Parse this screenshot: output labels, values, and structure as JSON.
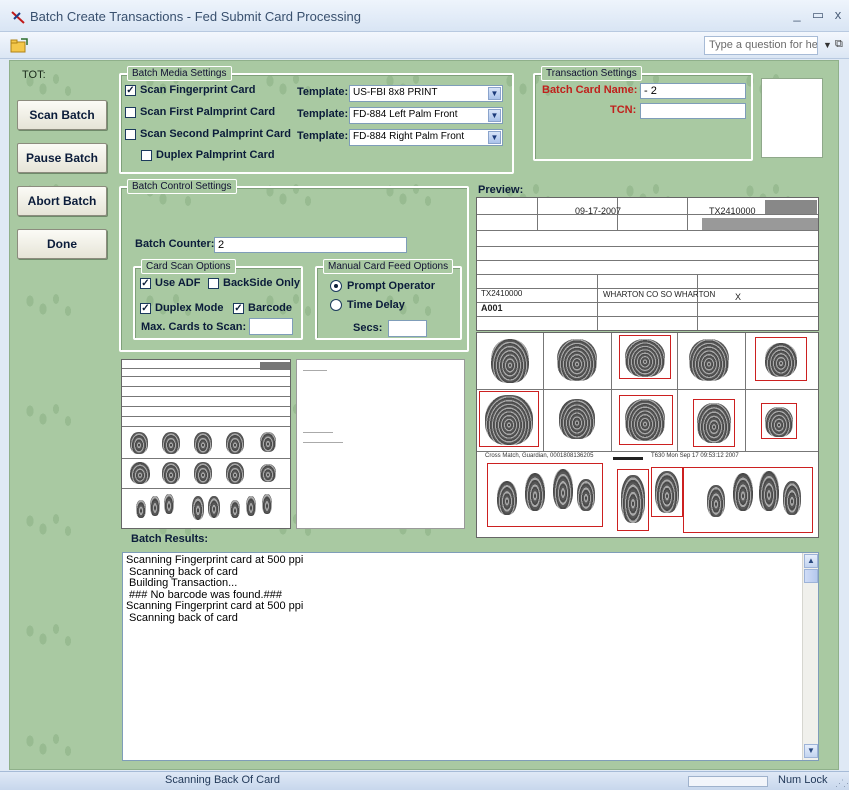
{
  "window": {
    "title": "Batch Create Transactions - Fed Submit Card Processing",
    "minimize_glyph": "_",
    "restore_glyph": "▭",
    "close_glyph": "x"
  },
  "toolbar": {
    "help_placeholder": "Type a question for help"
  },
  "left": {
    "tot_label": "TOT:",
    "buttons": [
      "Scan Batch",
      "Pause Batch",
      "Abort Batch",
      "Done"
    ]
  },
  "media_settings": {
    "legend": "Batch Media Settings",
    "rows": [
      {
        "label": "Scan Fingerprint Card",
        "checked": true,
        "template_label": "Template:",
        "template_value": "US-FBI 8x8 PRINT"
      },
      {
        "label": "Scan First Palmprint Card",
        "checked": false,
        "template_label": "Template:",
        "template_value": "FD-884 Left Palm Front"
      },
      {
        "label": "Scan Second Palmprint Card",
        "checked": false,
        "template_label": "Template:",
        "template_value": "FD-884 Right Palm Front"
      }
    ],
    "duplex_label": "Duplex Palmprint Card",
    "duplex_checked": false
  },
  "transaction_settings": {
    "legend": "Transaction Settings",
    "batch_card_name_label": "Batch Card Name:",
    "batch_card_name_value": "- 2",
    "tcn_label": "TCN:",
    "tcn_value": ""
  },
  "control_settings": {
    "legend": "Batch Control Settings",
    "batch_counter_label": "Batch Counter:",
    "batch_counter_value": "2",
    "card_scan_options": {
      "legend": "Card Scan Options",
      "use_adf": {
        "label": "Use ADF",
        "checked": true
      },
      "backside_only": {
        "label": "BackSide Only",
        "checked": false
      },
      "duplex_mode": {
        "label": "Duplex Mode",
        "checked": true
      },
      "barcode": {
        "label": "Barcode",
        "checked": true
      },
      "max_cards_label": "Max. Cards to Scan:",
      "max_cards_value": ""
    },
    "manual_feed": {
      "legend": "Manual Card Feed Options",
      "prompt_operator": {
        "label": "Prompt Operator",
        "selected": true
      },
      "time_delay": {
        "label": "Time Delay",
        "selected": false
      },
      "secs_label": "Secs:",
      "secs_value": ""
    }
  },
  "preview": {
    "label": "Preview:",
    "card_date": "09-17-2007",
    "card_id": "TX2410000",
    "card_id2": "TX2410000",
    "agency": "WHARTON CO SO WHARTON",
    "code": "A001",
    "mark": "X",
    "cross_match": "Cross Match, Guardian, 0001808136205",
    "timestamp": "T630 Mon Sep 17 09:53:12 2007"
  },
  "results": {
    "label": "Batch Results:",
    "lines": [
      "Scanning Fingerprint card at 500 ppi",
      " Scanning back of card",
      " Building Transaction...",
      " ### No barcode was found.###",
      "Scanning Fingerprint card at 500 ppi",
      " Scanning back of card"
    ]
  },
  "status": {
    "main": "Scanning Back Of Card",
    "num_lock": "Num Lock"
  }
}
